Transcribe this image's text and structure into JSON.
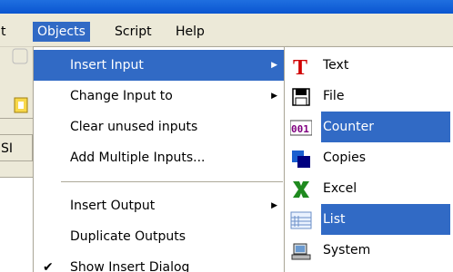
{
  "menubar": {
    "partial_label": "t",
    "items": [
      {
        "label": "Objects"
      },
      {
        "label": "Script"
      },
      {
        "label": "Help"
      }
    ]
  },
  "background": {
    "sh_label": "SI"
  },
  "objects_menu": {
    "items": [
      {
        "label": "Insert Input"
      },
      {
        "label": "Change Input to"
      },
      {
        "label": "Clear unused inputs"
      },
      {
        "label": "Add Multiple Inputs..."
      },
      {
        "label": "Insert Output"
      },
      {
        "label": "Duplicate Outputs"
      },
      {
        "label": "Show Insert Dialog"
      }
    ]
  },
  "insert_input_submenu": {
    "items": [
      {
        "label": "Text",
        "icon": "text-icon"
      },
      {
        "label": "File",
        "icon": "file-icon"
      },
      {
        "label": "Counter",
        "icon": "counter-icon"
      },
      {
        "label": "Copies",
        "icon": "copies-icon"
      },
      {
        "label": "Excel",
        "icon": "excel-icon"
      },
      {
        "label": "List",
        "icon": "list-icon"
      },
      {
        "label": "System",
        "icon": "system-icon"
      }
    ]
  },
  "colors": {
    "highlight": "#316ac5",
    "menu_bg": "#ffffff",
    "bar_bg": "#ece9d8",
    "title_blue": "#0a55d0"
  }
}
